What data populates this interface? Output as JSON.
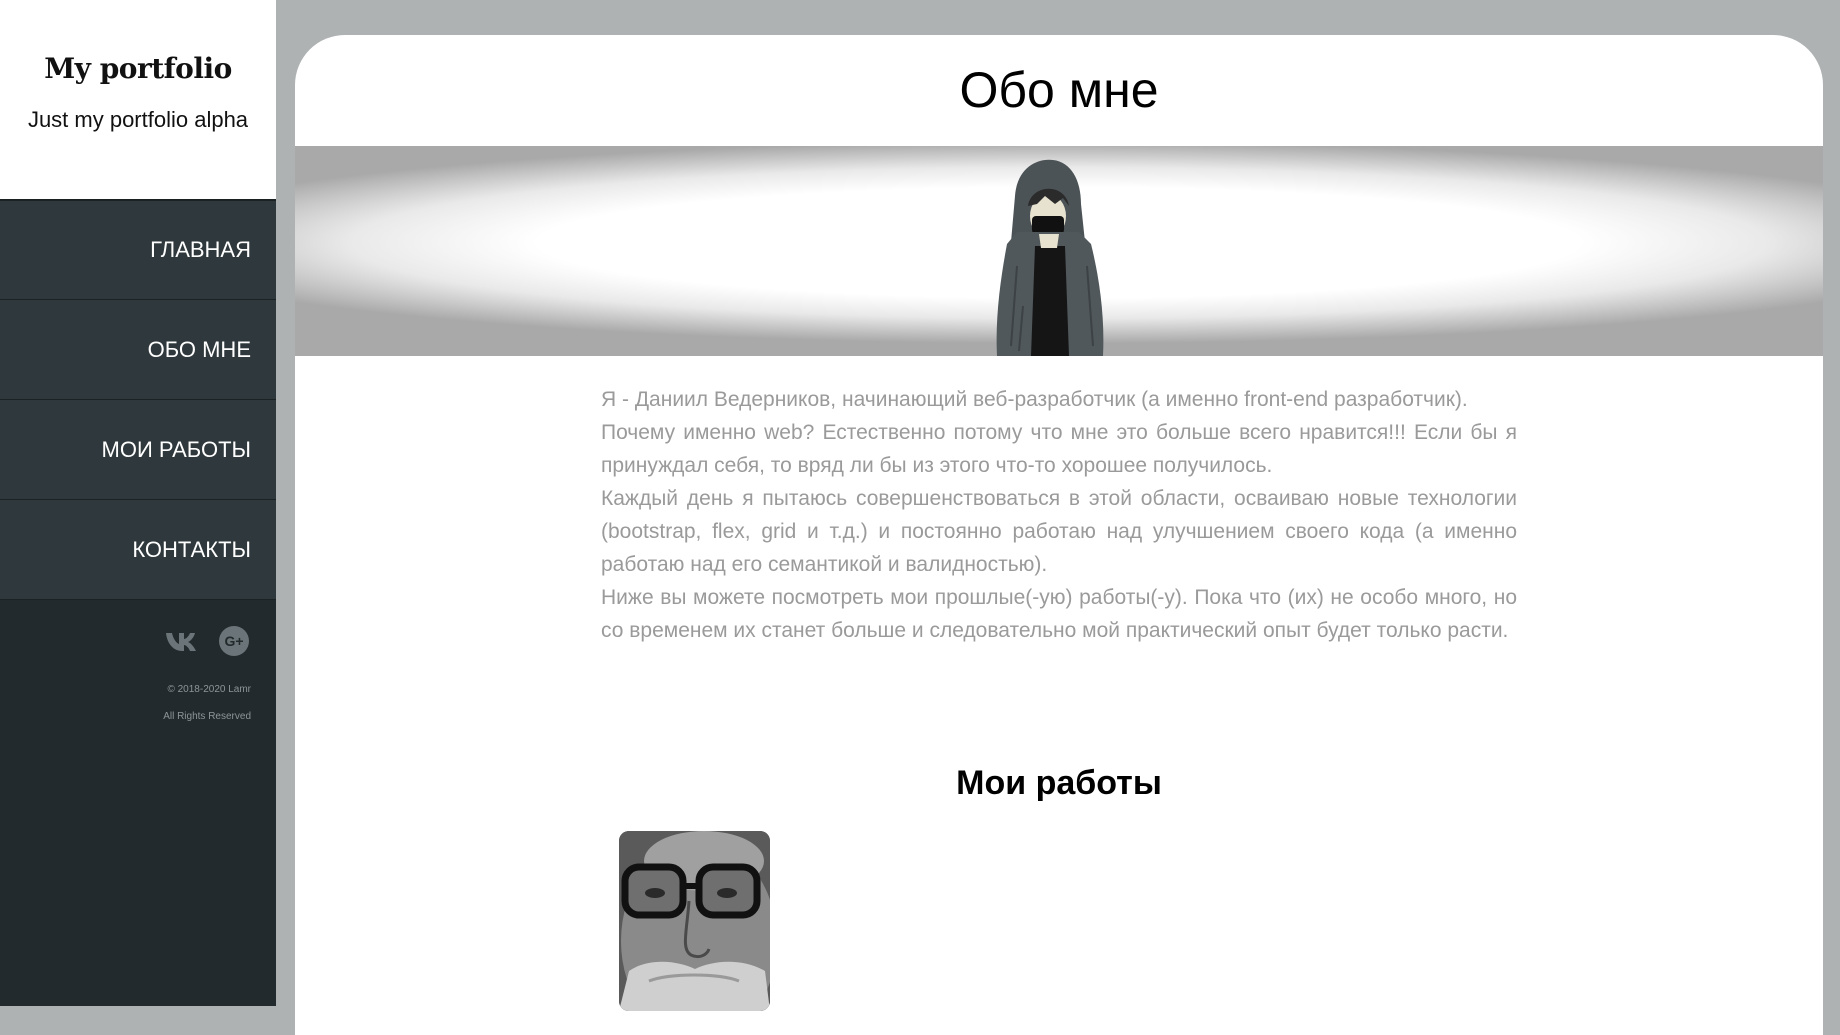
{
  "sidebar": {
    "brand_title": "My portfolio",
    "brand_subtitle": "Just my portfolio alpha",
    "nav": [
      {
        "label": "ГЛАВНАЯ"
      },
      {
        "label": "ОБО МНЕ"
      },
      {
        "label": "МОИ РАБОТЫ"
      },
      {
        "label": "КОНТАКТЫ"
      }
    ],
    "socials": [
      {
        "icon": "vk-icon"
      },
      {
        "icon": "google-plus-icon"
      }
    ],
    "copyright_line1": "© 2018-2020 Lamr",
    "copyright_line2": "All Rights Reserved"
  },
  "main": {
    "title": "Обо мне",
    "about_paragraphs": [
      "Я - Даниил Ведерников, начинающий веб-разработчик (а именно front-end разработчик).",
      "Почему именно web? Естественно потому что мне это больше всего нравится!!! Если бы я принуждал себя, то вряд ли бы из этого что-то хорошее получилось.",
      "Каждый день я пытаюсь совершенствоваться в этой области, осваиваю новые технологии (bootstrap, flex, grid и т.д.) и постоянно работаю над улучшением своего кода (а именно работаю над его семантикой и валидностью).",
      "Ниже вы можете посмотреть мои прошлые(-ую) работы(-у). Пока что (их) не особо много, но со временем их станет больше и следовательно мой практический опыт будет только расти."
    ],
    "works_title": "Мои работы"
  },
  "colors": {
    "sidebar_bg": "#222a2d",
    "nav_bg": "#2f383c",
    "page_bg": "#aeb2b3",
    "body_text": "#9a9a9a"
  }
}
